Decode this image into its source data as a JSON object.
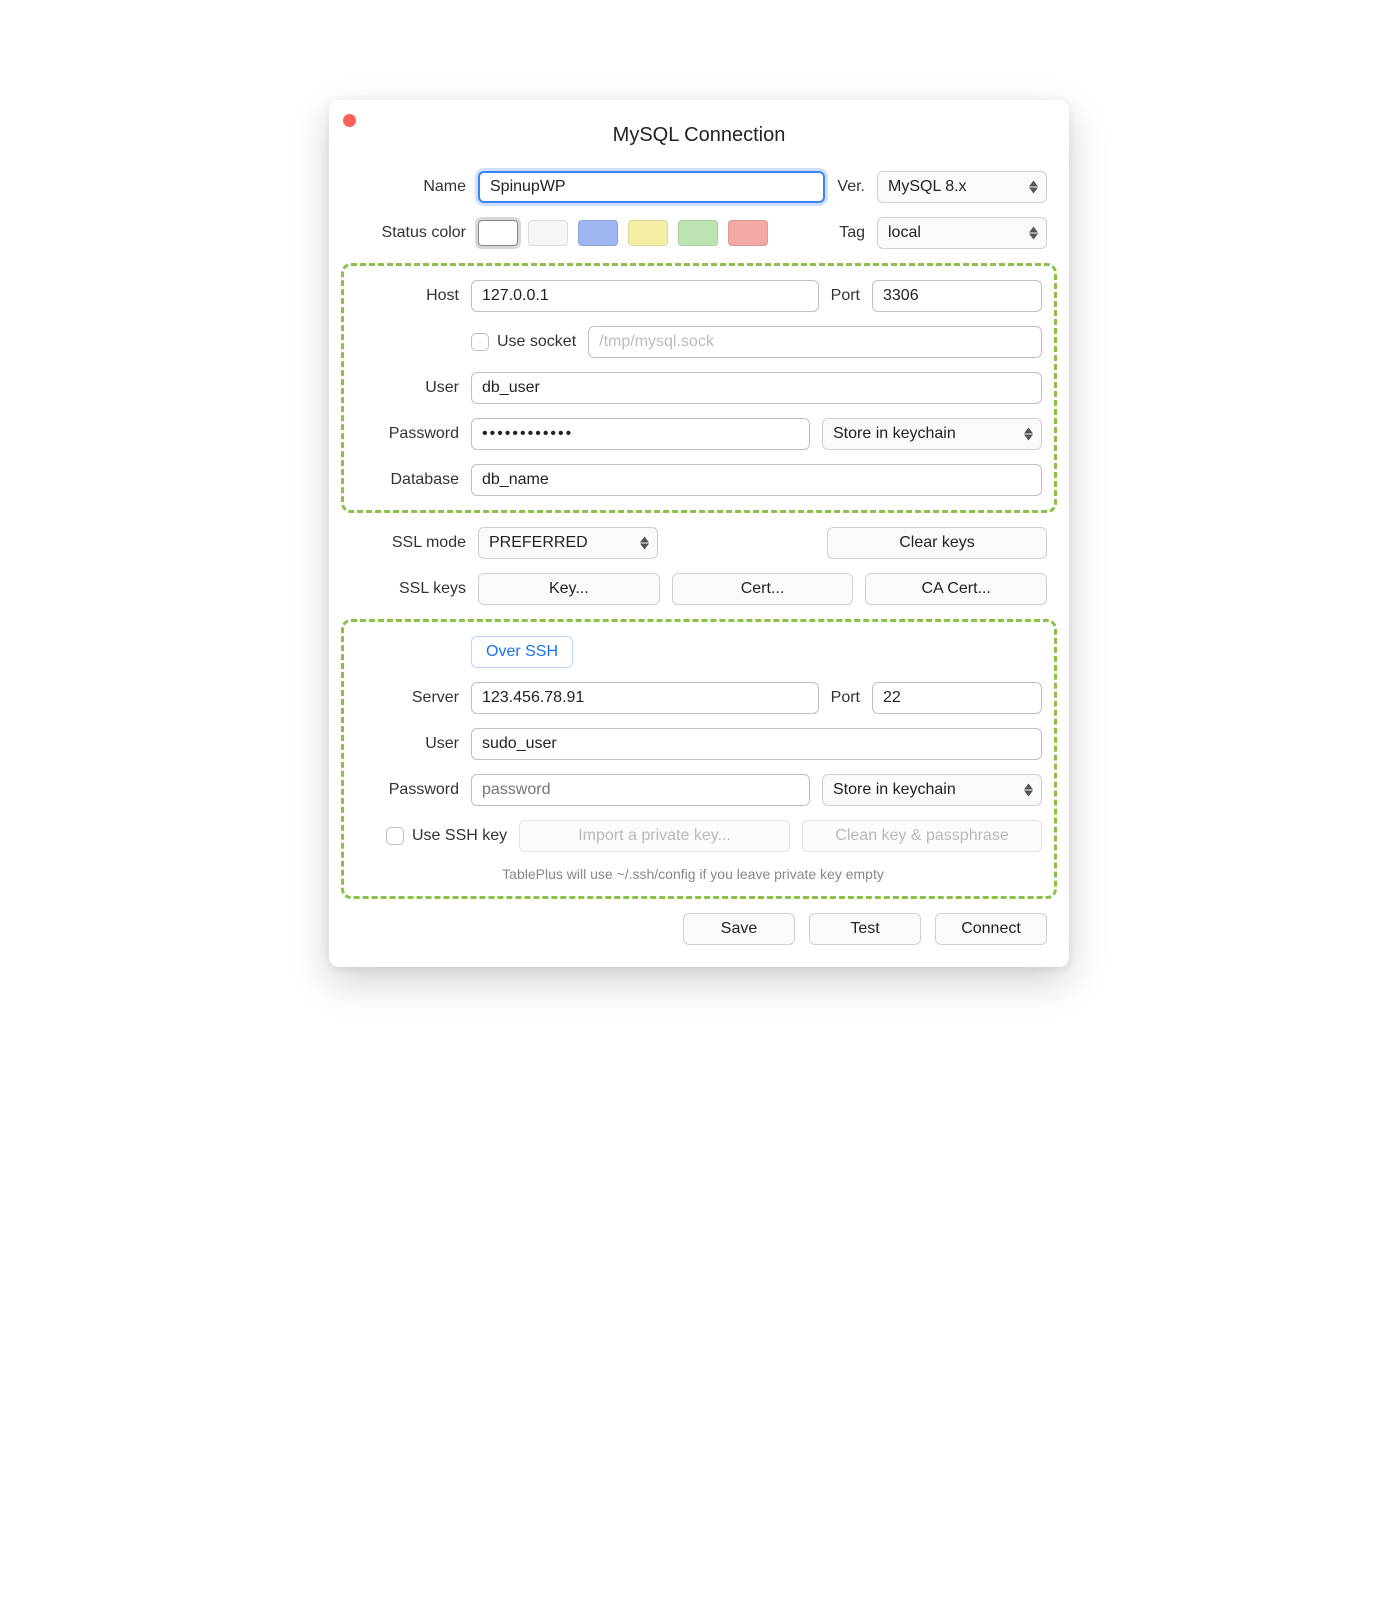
{
  "window": {
    "title": "MySQL Connection"
  },
  "name_row": {
    "label": "Name",
    "value": "SpinupWP",
    "version_label": "Ver.",
    "version_value": "MySQL 8.x"
  },
  "status_row": {
    "label": "Status color",
    "swatches": [
      {
        "name": "swatch-none",
        "color": "#ffffff",
        "selected": true
      },
      {
        "name": "swatch-white",
        "color": "#f5f5f5"
      },
      {
        "name": "swatch-blue",
        "color": "#9fb6f0"
      },
      {
        "name": "swatch-yellow",
        "color": "#f5eea6"
      },
      {
        "name": "swatch-green",
        "color": "#bee3b2"
      },
      {
        "name": "swatch-red",
        "color": "#f3aaa6"
      }
    ],
    "tag_label": "Tag",
    "tag_value": "local"
  },
  "db": {
    "host_label": "Host",
    "host": "127.0.0.1",
    "port_label": "Port",
    "port": "3306",
    "socket_label": "Use socket",
    "socket_placeholder": "/tmp/mysql.sock",
    "user_label": "User",
    "user": "db_user",
    "password_label": "Password",
    "password": "••••••••••••",
    "keychain_value": "Store in keychain",
    "database_label": "Database",
    "database": "db_name"
  },
  "ssl": {
    "mode_label": "SSL mode",
    "mode_value": "PREFERRED",
    "clear_keys_label": "Clear keys",
    "keys_label": "SSL keys",
    "key_btn": "Key...",
    "cert_btn": "Cert...",
    "ca_btn": "CA Cert..."
  },
  "ssh": {
    "over_ssh_label": "Over SSH",
    "server_label": "Server",
    "server": "123.456.78.91",
    "port_label": "Port",
    "port": "22",
    "user_label": "User",
    "user": "sudo_user",
    "password_label": "Password",
    "password_placeholder": "password",
    "keychain_value": "Store in keychain",
    "use_key_label": "Use SSH key",
    "import_btn": "Import a private key...",
    "clean_btn": "Clean key & passphrase",
    "hint": "TablePlus will use ~/.ssh/config if you leave private key empty"
  },
  "footer": {
    "save": "Save",
    "test": "Test",
    "connect": "Connect"
  }
}
